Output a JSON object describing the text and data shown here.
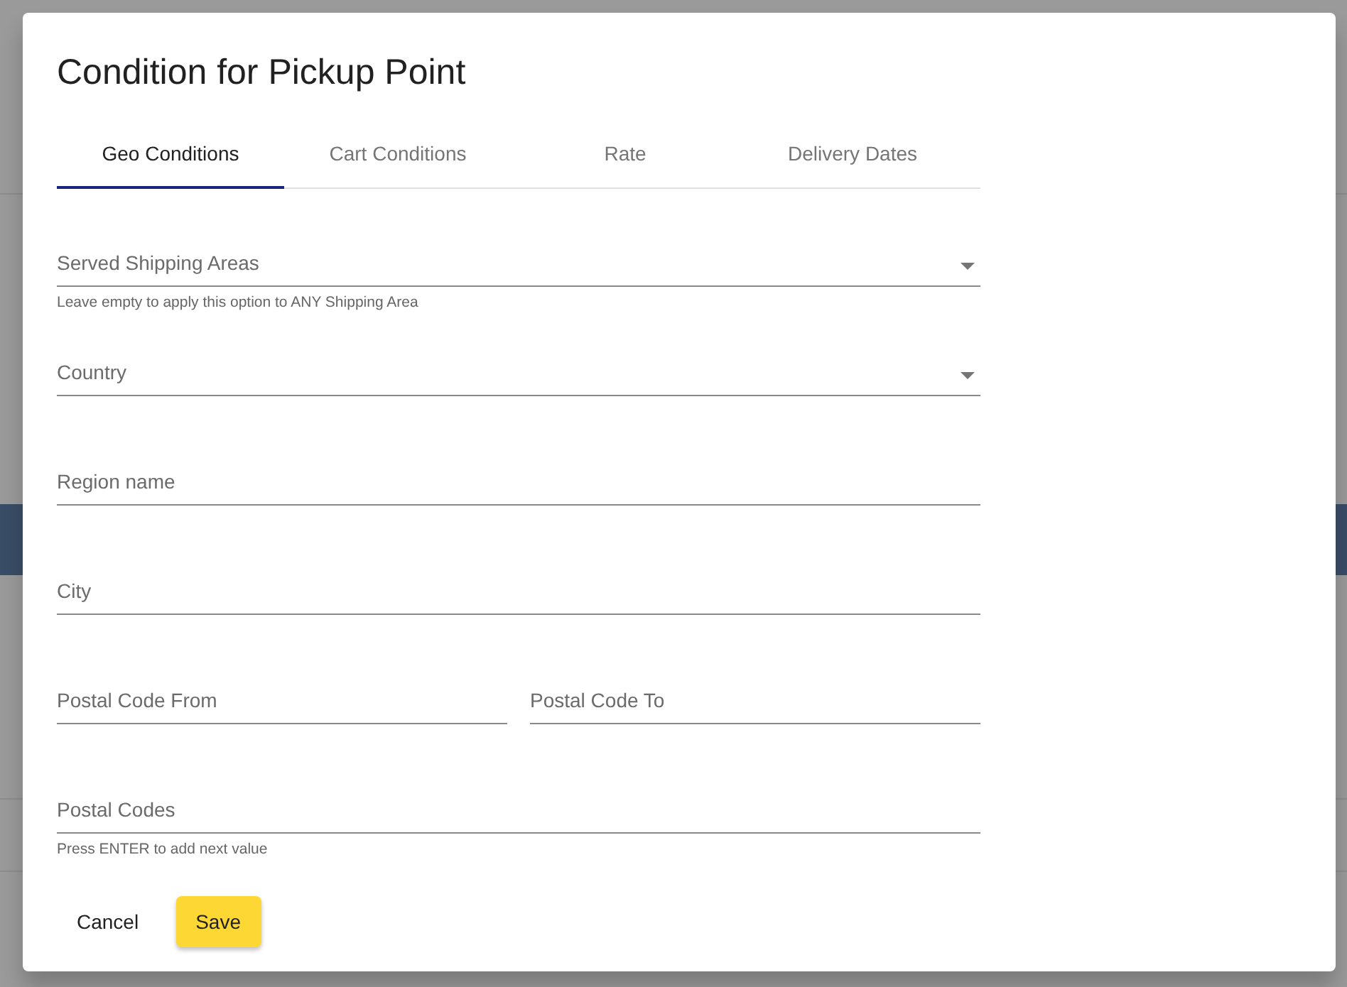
{
  "dialog": {
    "title": "Condition for Pickup Point"
  },
  "tabs": [
    {
      "label": "Geo Conditions",
      "selected": true
    },
    {
      "label": "Cart Conditions",
      "selected": false
    },
    {
      "label": "Rate",
      "selected": false
    },
    {
      "label": "Delivery Dates",
      "selected": false
    }
  ],
  "rows": [
    {
      "fields": [
        {
          "kind": "select",
          "placeholder": "Served Shipping Areas"
        }
      ],
      "helper": "Leave empty to apply this option to ANY Shipping Area"
    },
    {
      "fields": [
        {
          "kind": "select",
          "placeholder": "Country"
        }
      ]
    },
    {
      "fields": [
        {
          "kind": "text",
          "placeholder": "Region name"
        }
      ]
    },
    {
      "fields": [
        {
          "kind": "text",
          "placeholder": "City"
        }
      ]
    },
    {
      "fields": [
        {
          "kind": "text",
          "placeholder": "Postal Code From"
        },
        {
          "kind": "text",
          "placeholder": "Postal Code To"
        }
      ]
    },
    {
      "fields": [
        {
          "kind": "text",
          "placeholder": "Postal Codes"
        }
      ],
      "helper": "Press ENTER to add next value"
    }
  ],
  "buttons": [
    {
      "label": "Cancel",
      "kind": "text"
    },
    {
      "label": "Save",
      "kind": "primary"
    }
  ]
}
